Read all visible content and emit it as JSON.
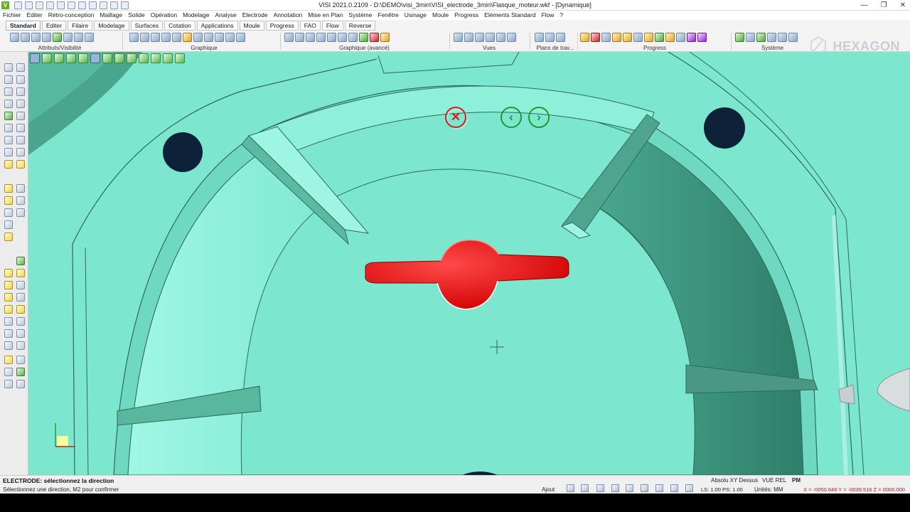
{
  "window": {
    "title": "VISI 2021.0.2109 - D:\\DEMO\\visi_3min\\VISI_electrode_3min\\Flasque_moteur.wkf - [Dynamique]",
    "controls": [
      "—",
      "❐",
      "✕"
    ],
    "brand": "HEXAGON"
  },
  "menu": [
    "Fichier",
    "Editer",
    "Rétro-conception",
    "Maillage",
    "Solide",
    "Opération",
    "Modelage",
    "Analyse",
    "Electrode",
    "Annotation",
    "Mise en Plan",
    "Système",
    "Fenêtre",
    "Usinage",
    "Moule",
    "Progress",
    "Eléments Standard",
    "Flow",
    "?"
  ],
  "tabs": [
    {
      "label": "Standard",
      "active": true
    },
    {
      "label": "Editer"
    },
    {
      "label": "Filaire"
    },
    {
      "label": "Modelage"
    },
    {
      "label": "Surfaces"
    },
    {
      "label": "Cotation"
    },
    {
      "label": "Applications"
    },
    {
      "label": "Moule"
    },
    {
      "label": "Progress"
    },
    {
      "label": "FAO"
    },
    {
      "label": "Flow"
    },
    {
      "label": "Reverse"
    }
  ],
  "ribbon_groups": {
    "attributs": "Attributs/Visibilité",
    "graphique": "Graphique",
    "graphique_avance": "Graphique (avancé)",
    "vues": "Vues",
    "plans": "Plans de trav...",
    "progress": "Progress",
    "systeme": "Système"
  },
  "viewport": {
    "background_color": "#7de6cf",
    "part_color": "#7de6cf",
    "electrode_color": "#e00000",
    "hole_color": "#0d2238",
    "controls": {
      "cancel": "✕",
      "prev": "‹",
      "next": "›"
    }
  },
  "status": {
    "prompt": "ELECTRODE: sélectionnez la direction",
    "hint": "Sélectionnez une direction, M2 pour confirmer",
    "mode": "Ajout",
    "view": "Absolu XY Dessus",
    "view_rel": "VUE REL",
    "pm": "PM",
    "ls": "LS: 1.00 PS: 1.00",
    "units": "Unités: MM",
    "coords": "X = -0050.649 Y = -0039.516 Z = 0000.000"
  }
}
